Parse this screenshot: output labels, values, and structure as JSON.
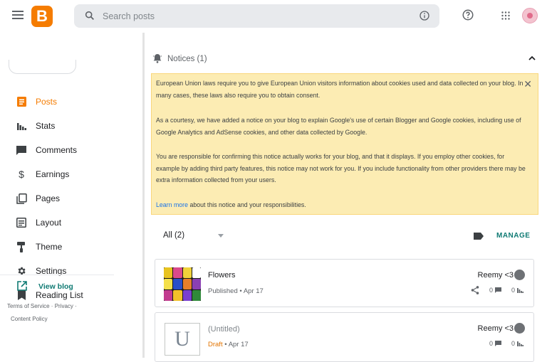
{
  "header": {
    "search_placeholder": "Search posts",
    "logo_letter": "B"
  },
  "sidebar": {
    "items": [
      {
        "label": "Posts",
        "icon": "posts-icon",
        "active": true
      },
      {
        "label": "Stats",
        "icon": "stats-icon"
      },
      {
        "label": "Comments",
        "icon": "comments-icon"
      },
      {
        "label": "Earnings",
        "icon": "dollar-icon"
      },
      {
        "label": "Pages",
        "icon": "pages-icon"
      },
      {
        "label": "Layout",
        "icon": "layout-icon"
      },
      {
        "label": "Theme",
        "icon": "theme-roller-icon"
      },
      {
        "label": "Settings",
        "icon": "gear-icon"
      },
      {
        "label": "Reading List",
        "icon": "bookmark-icon"
      }
    ],
    "view_blog": "View blog",
    "footer": {
      "terms": "Terms of Service",
      "privacy": "Privacy",
      "content_policy": "Content Policy"
    }
  },
  "notices": {
    "title": "Notices (1)",
    "para1": "European Union laws require you to give European Union visitors information about cookies used and data collected on your blog. In many cases, these laws also require you to obtain consent.",
    "para2": "As a courtesy, we have added a notice on your blog to explain Google's use of certain Blogger and Google cookies, including use of Google Analytics and AdSense cookies, and other data collected by Google.",
    "para3": "You are responsible for confirming this notice actually works for your blog, and that it displays. If you employ other cookies, for example by adding third party features, this notice may not work for you. If you include functionality from other providers there may be extra information collected from your users.",
    "learn_more": "Learn more",
    "learn_more_rest": " about this notice and your responsibilities."
  },
  "filter": {
    "selected": "All (2)",
    "manage": "MANAGE"
  },
  "posts": [
    {
      "title": "Flowers",
      "status": "Published",
      "date": "Apr 17",
      "author": "Reemy <3",
      "comments": "0",
      "views": "0"
    },
    {
      "title": "(Untitled)",
      "status": "Draft",
      "date": "Apr 17",
      "author": "Reemy <3",
      "comments": "0",
      "views": "0",
      "thumb_letter": "U"
    }
  ],
  "colors": {
    "brand": "#f57c00",
    "accent": "#0f7a73",
    "notice_bg": "#fcecb3"
  }
}
